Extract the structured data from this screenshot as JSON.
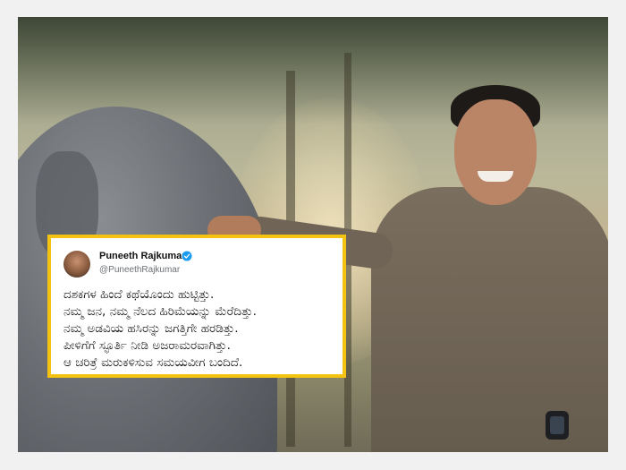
{
  "tweet": {
    "name": "Puneeth Rajkumar",
    "handle": "@PuneethRajkumar",
    "verified_color": "#1d9bf0",
    "lines": [
      "ದಶಕಗಳ ಹಿಂದೆ ಕಥೆಯೊಂದು ಹುಟ್ಟಿತ್ತು.",
      "ನಮ್ಮ ಜನ, ನಮ್ಮ ನೆಲದ ಹಿರಿಮೆಯನ್ನು ಮೆರೆದಿತ್ತು.",
      "ನಮ್ಮ ಅಡವಿಯ ಹಸಿರನ್ನು ಜಗತ್ತಿಗೇ ಹರಡಿತ್ತು.",
      "ಪೀಳಿಗೆಗೆ ಸ್ಫೂರ್ತಿ ನೀಡಿ ಅಜರಾಮರವಾಗಿತ್ತು.",
      "ಆ ಚರಿತ್ರೆ ಮರುಕಳಿಸುವ ಸಮಯವೀಗ ಬಂದಿದೆ."
    ],
    "border_color": "#f3c30f"
  }
}
